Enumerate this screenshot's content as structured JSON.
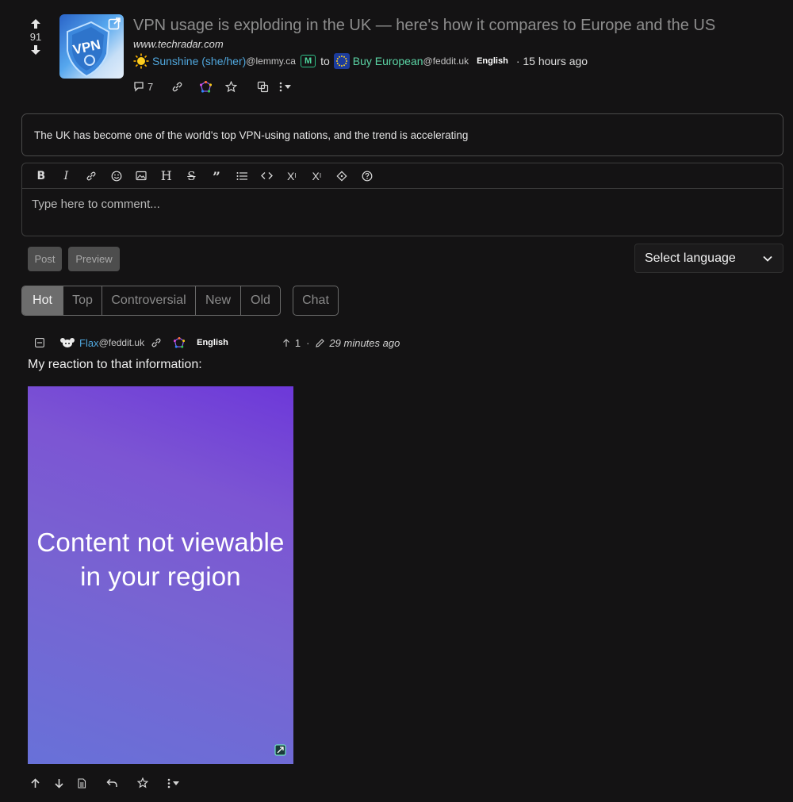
{
  "post": {
    "score": "91",
    "title": "VPN usage is exploding in the UK — here's how it compares to Europe and the US",
    "domain": "www.techradar.com",
    "thumbnail_text": "VPN",
    "author_name": "Sunshine (she/her)",
    "author_instance": "@lemmy.ca",
    "mod_badge": "M",
    "to_text": "to",
    "community_name": "Buy European",
    "community_instance": "@feddit.uk",
    "language": "English",
    "time": "· 15 hours ago",
    "comment_count": "7",
    "body": "The UK has become one of the world's top VPN-using nations, and the trend is accelerating"
  },
  "editor": {
    "placeholder": "Type here to comment...",
    "toolbar_icons": [
      "bold-icon",
      "italic-icon",
      "link-icon",
      "emoji-icon",
      "image-icon",
      "header-icon",
      "strikethrough-icon",
      "quote-icon",
      "list-icon",
      "code-icon",
      "subscript-icon",
      "superscript-icon",
      "spoiler-icon",
      "help-icon"
    ]
  },
  "buttons": {
    "post": "Post",
    "preview": "Preview",
    "select_language": "Select language"
  },
  "sort": {
    "options": [
      "Hot",
      "Top",
      "Controversial",
      "New",
      "Old"
    ],
    "active": "Hot",
    "chat": "Chat"
  },
  "comment": {
    "author_name": "Flax",
    "author_instance": "@feddit.uk",
    "language": "English",
    "score": "1",
    "separator": "·",
    "time": "29 minutes ago",
    "text": "My reaction to that information:",
    "image_line1": "Content not viewable",
    "image_line2": "in your region"
  },
  "colors": {
    "background": "#141314",
    "link_blue": "#4fa6dc",
    "link_green": "#5bd4a5",
    "active_sort": "#6d6d6d"
  }
}
